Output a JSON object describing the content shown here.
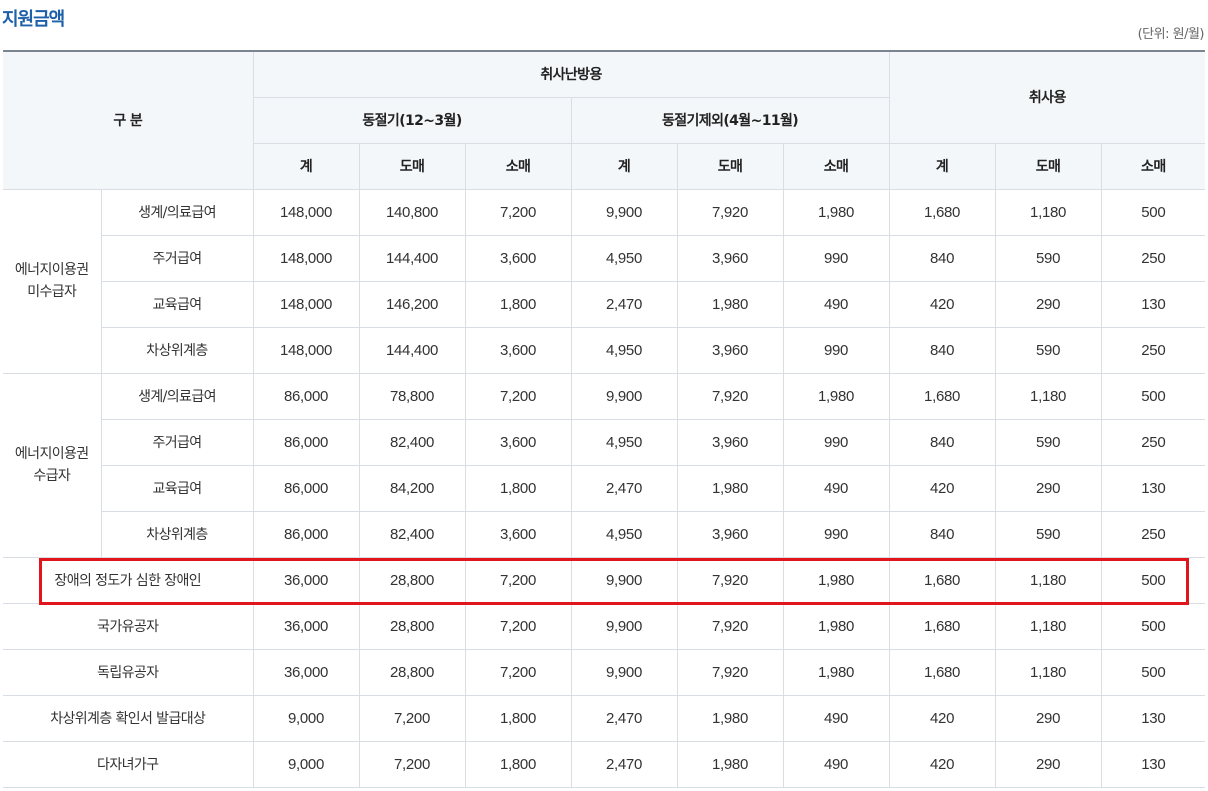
{
  "title": "지원금액",
  "unit": "(단위: 원/월)",
  "header": {
    "category": "구 분",
    "heating": "취사난방용",
    "winter": "동절기(12~3월)",
    "non_winter": "동절기제외(4월~11월)",
    "cooking": "취사용",
    "total": "계",
    "wholesale": "도매",
    "retail": "소매"
  },
  "groups": [
    {
      "label": "에너지이용권\n미수급자",
      "rows": [
        {
          "sub": "생계/의료급여",
          "values": [
            "148,000",
            "140,800",
            "7,200",
            "9,900",
            "7,920",
            "1,980",
            "1,680",
            "1,180",
            "500"
          ]
        },
        {
          "sub": "주거급여",
          "values": [
            "148,000",
            "144,400",
            "3,600",
            "4,950",
            "3,960",
            "990",
            "840",
            "590",
            "250"
          ]
        },
        {
          "sub": "교육급여",
          "values": [
            "148,000",
            "146,200",
            "1,800",
            "2,470",
            "1,980",
            "490",
            "420",
            "290",
            "130"
          ]
        },
        {
          "sub": "차상위계층",
          "values": [
            "148,000",
            "144,400",
            "3,600",
            "4,950",
            "3,960",
            "990",
            "840",
            "590",
            "250"
          ]
        }
      ]
    },
    {
      "label": "에너지이용권\n수급자",
      "rows": [
        {
          "sub": "생계/의료급여",
          "values": [
            "86,000",
            "78,800",
            "7,200",
            "9,900",
            "7,920",
            "1,980",
            "1,680",
            "1,180",
            "500"
          ]
        },
        {
          "sub": "주거급여",
          "values": [
            "86,000",
            "82,400",
            "3,600",
            "4,950",
            "3,960",
            "990",
            "840",
            "590",
            "250"
          ]
        },
        {
          "sub": "교육급여",
          "values": [
            "86,000",
            "84,200",
            "1,800",
            "2,470",
            "1,980",
            "490",
            "420",
            "290",
            "130"
          ]
        },
        {
          "sub": "차상위계층",
          "values": [
            "86,000",
            "82,400",
            "3,600",
            "4,950",
            "3,960",
            "990",
            "840",
            "590",
            "250"
          ]
        }
      ]
    }
  ],
  "single_rows": [
    {
      "label": "장애의 정도가 심한 장애인",
      "values": [
        "36,000",
        "28,800",
        "7,200",
        "9,900",
        "7,920",
        "1,980",
        "1,680",
        "1,180",
        "500"
      ]
    },
    {
      "label": "국가유공자",
      "values": [
        "36,000",
        "28,800",
        "7,200",
        "9,900",
        "7,920",
        "1,980",
        "1,680",
        "1,180",
        "500"
      ]
    },
    {
      "label": "독립유공자",
      "values": [
        "36,000",
        "28,800",
        "7,200",
        "9,900",
        "7,920",
        "1,980",
        "1,680",
        "1,180",
        "500"
      ]
    },
    {
      "label": "차상위계층 확인서 발급대상",
      "values": [
        "9,000",
        "7,200",
        "1,800",
        "2,470",
        "1,980",
        "490",
        "420",
        "290",
        "130"
      ]
    },
    {
      "label": "다자녀가구",
      "values": [
        "9,000",
        "7,200",
        "1,800",
        "2,470",
        "1,980",
        "490",
        "420",
        "290",
        "130"
      ]
    }
  ],
  "highlight_color": "#e1161c"
}
